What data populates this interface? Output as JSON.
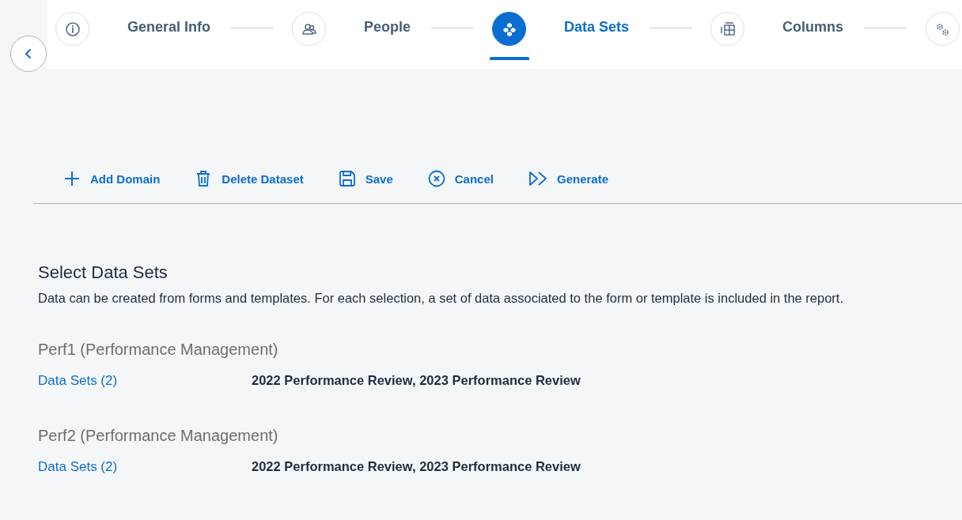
{
  "steps": [
    {
      "kind": "info",
      "label": "General Info",
      "selected": false
    },
    {
      "kind": "people",
      "label": "People",
      "selected": false
    },
    {
      "kind": "cube",
      "label": "Data Sets",
      "selected": true
    },
    {
      "kind": "grid",
      "label": "Columns",
      "selected": false
    },
    {
      "kind": "gears",
      "selected": false
    }
  ],
  "toolbar": [
    {
      "kind": "add",
      "label": "Add Domain"
    },
    {
      "kind": "delete",
      "label": "Delete Dataset"
    },
    {
      "kind": "save",
      "label": "Save"
    },
    {
      "kind": "cancel",
      "label": "Cancel"
    },
    {
      "kind": "generate",
      "label": "Generate"
    }
  ],
  "section": {
    "title": "Select Data Sets",
    "description": "Data can be created from forms and templates. For each selection, a set of data associated to the form or template is included in the report."
  },
  "groups": [
    {
      "title": "Perf1 (Performance Management)",
      "link": "Data Sets (2)",
      "value": "2022 Performance Review, 2023 Performance Review"
    },
    {
      "title": "Perf2 (Performance Management)",
      "link": "Data Sets (2)",
      "value": "2022 Performance Review, 2023 Performance Review"
    }
  ]
}
